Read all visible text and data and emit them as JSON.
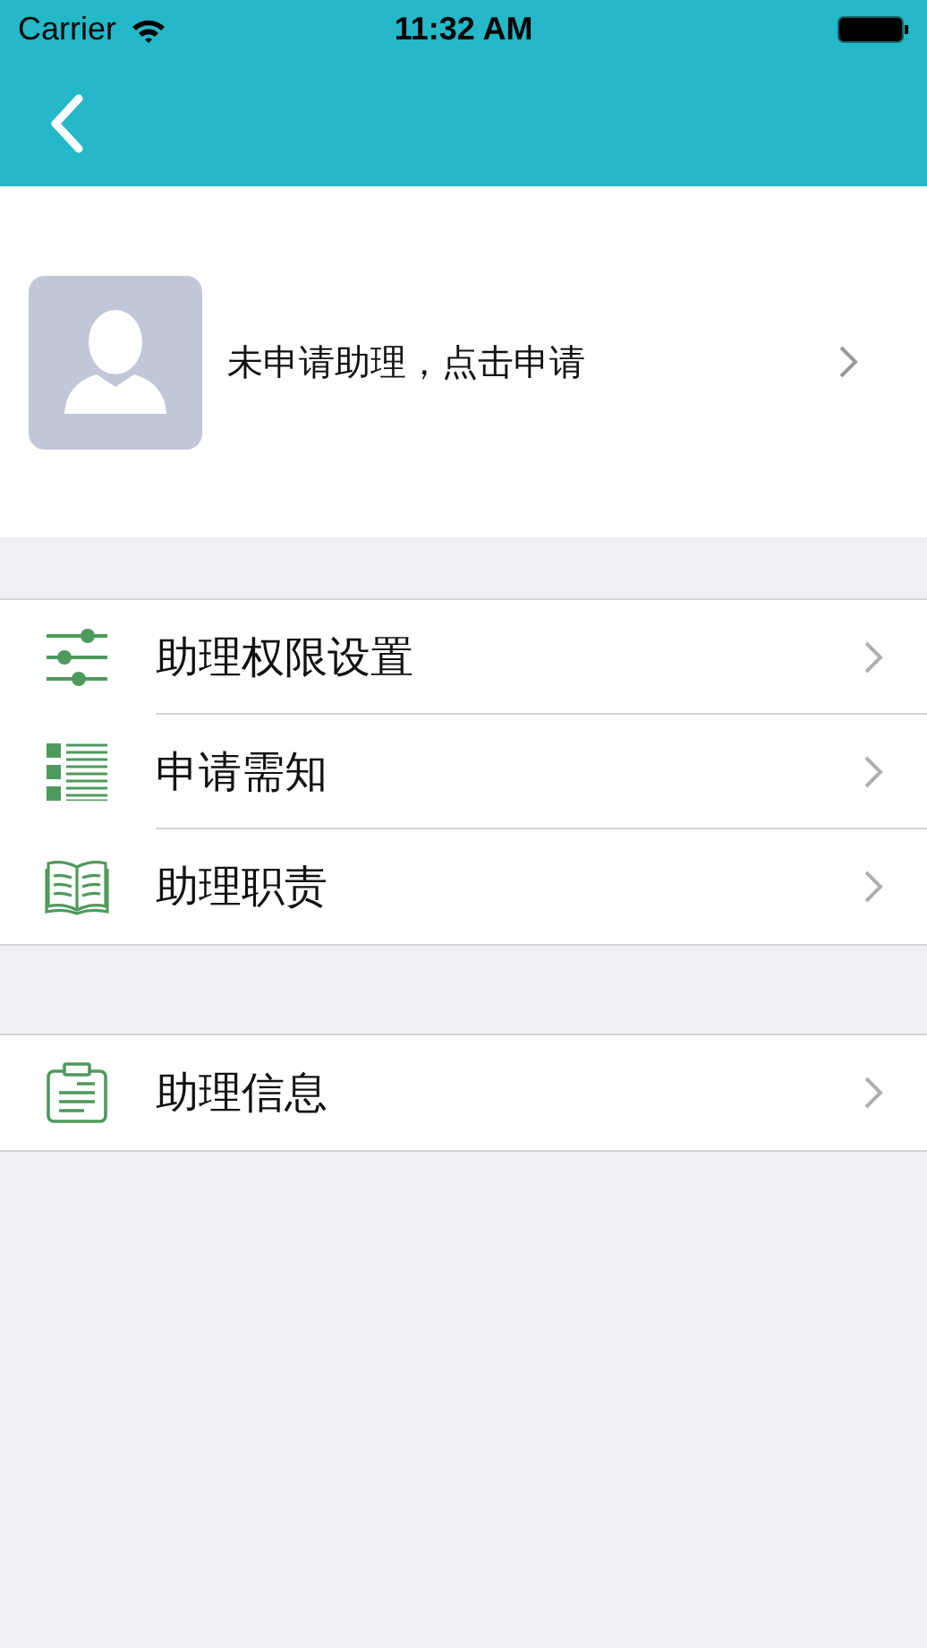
{
  "status_bar": {
    "carrier": "Carrier",
    "time": "11:32 AM"
  },
  "profile": {
    "text": "未申请助理，点击申请"
  },
  "menu_groups": [
    {
      "items": [
        {
          "kind": "sliders",
          "label": "助理权限设置"
        },
        {
          "kind": "list",
          "label": "申请需知"
        },
        {
          "kind": "book",
          "label": "助理职责"
        }
      ]
    },
    {
      "items": [
        {
          "kind": "clipboard",
          "label": "助理信息"
        }
      ]
    }
  ]
}
